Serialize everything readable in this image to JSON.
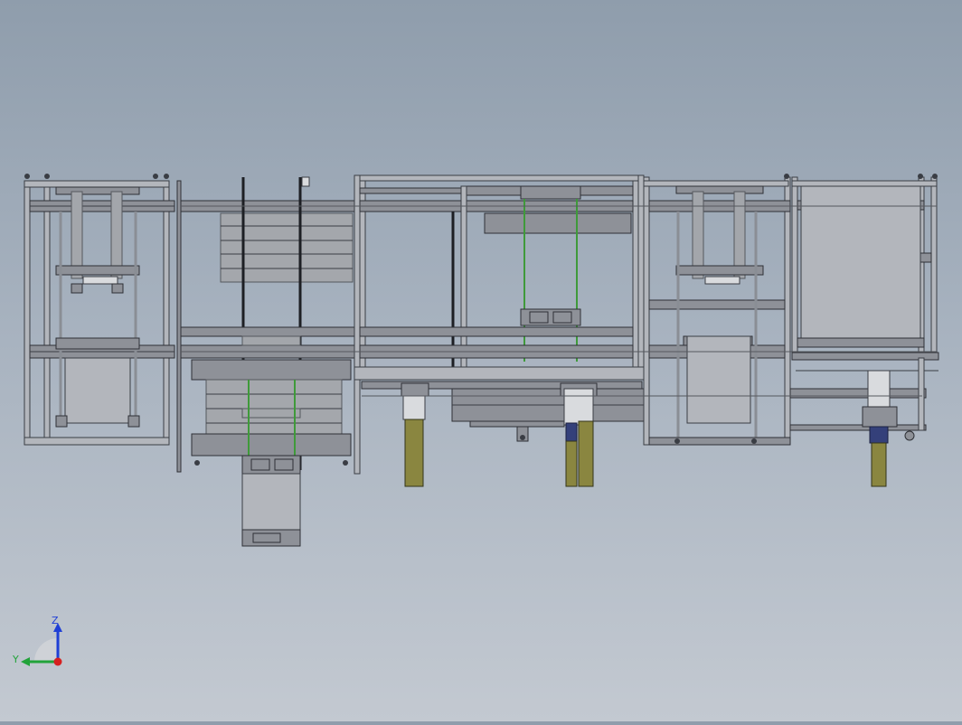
{
  "viewport": {
    "background_top": "#8f9dac",
    "background_bottom": "#c3c9d1",
    "frame_color": "#a9adb5",
    "frame_edge": "#3a3d44",
    "rail_green": "#3f9a3a",
    "bracket_olive": "#8a8640",
    "block_navy": "#34407a",
    "plate_gray": "#9c9fa4"
  },
  "triad": {
    "z_label": "Z",
    "y_label": "Y",
    "z_color": "#1f3fd6",
    "y_color": "#22a33a",
    "x_color": "#d62020"
  }
}
